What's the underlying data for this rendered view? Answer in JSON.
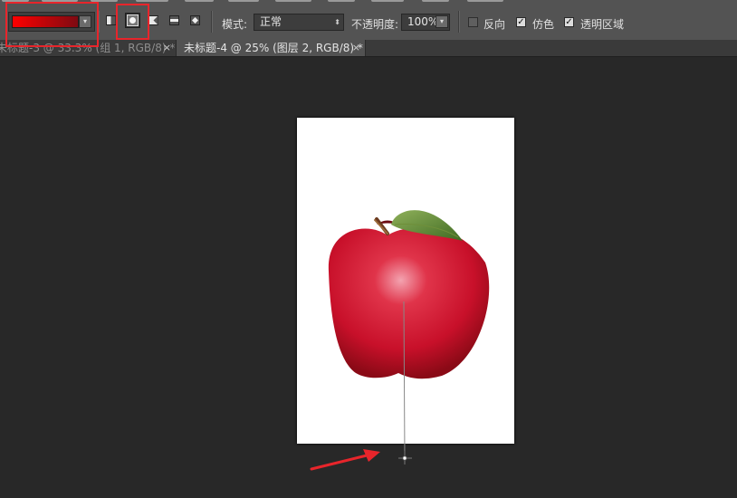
{
  "optionsbar": {
    "gradient_colors": [
      "#ff0000",
      "#7d0a12"
    ],
    "dropdown_glyph": "▾",
    "gradient_types": [
      {
        "name": "linear-gradient-icon",
        "selected": false
      },
      {
        "name": "radial-gradient-icon",
        "selected": true
      },
      {
        "name": "angle-gradient-icon",
        "selected": false
      },
      {
        "name": "reflected-gradient-icon",
        "selected": false
      },
      {
        "name": "diamond-gradient-icon",
        "selected": false
      }
    ],
    "mode_label": "模式:",
    "mode_value": "正常",
    "opacity_label": "不透明度:",
    "opacity_value": "100%",
    "reverse_label": "反向",
    "reverse_checked": false,
    "dither_label": "仿色",
    "dither_checked": true,
    "transparency_label": "透明区域",
    "transparency_checked": true,
    "check_glyph": "✓"
  },
  "tabs": [
    {
      "label": "未标题-3 @ 33.3% (组 1, RGB/8) *",
      "active": false
    },
    {
      "label": "未标题-4 @ 25% (图层 2, RGB/8) *",
      "active": true
    }
  ],
  "tab_close_glyph": "×",
  "highlight_color": "#e8252b",
  "arrow_color": "#e8252b"
}
